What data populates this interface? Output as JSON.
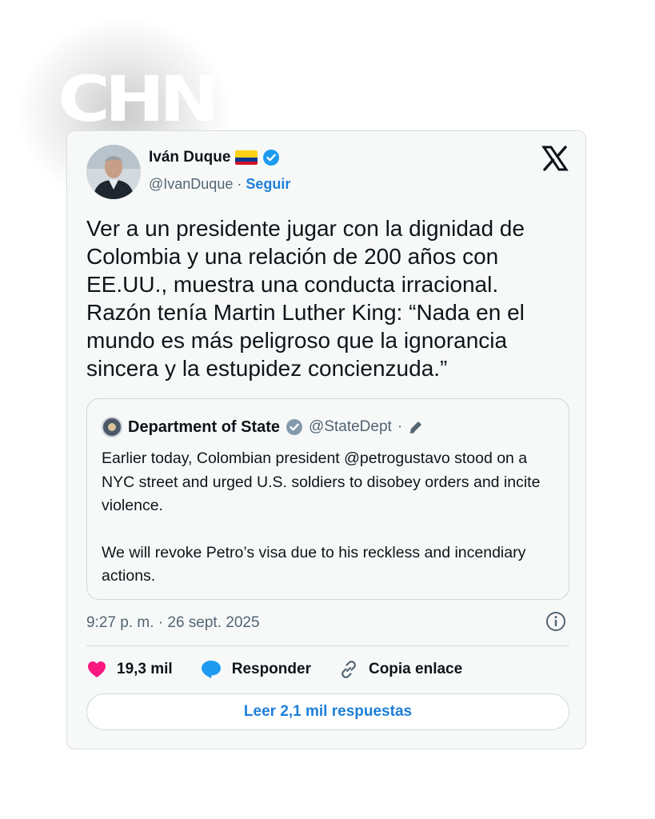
{
  "watermark": {
    "text": "CHN"
  },
  "tweet": {
    "author_name": "Iván Duque",
    "author_handle": "@IvanDuque",
    "separator": " · ",
    "follow_label": "Seguir",
    "text": "Ver a un presidente jugar con la dignidad de Colombia y una relación de 200 años con EE.UU., muestra una conducta irracional. Razón tenía Martin Luther King: “Nada en el mundo es más peligroso que la ignorancia sincera y la estupidez concienzuda.”",
    "timestamp": "9:27 p. m. · 26 sept. 2025",
    "likes": "19,3 mil",
    "reply_label": "Responder",
    "copy_link_label": "Copia enlace",
    "read_replies_label": "Leer 2,1 mil respuestas"
  },
  "quoted_tweet": {
    "author_name": "Department of State",
    "author_handle": "@StateDept",
    "separator": " · ",
    "paragraph_1": "Earlier today, Colombian president @petrogustavo stood on a NYC street and urged U.S. soldiers to disobey orders and incite violence.",
    "paragraph_2": "We will revoke Petro’s visa due to his reckless and incendiary actions."
  },
  "colors": {
    "accent_blue": "#1d7fd9",
    "verified_blue": "#1d9bf0",
    "verified_gray": "#829aab",
    "like_pink": "#f91880"
  },
  "icons": [
    "colombia-flag-icon",
    "verified-badge-icon",
    "x-logo-icon",
    "state-seal-icon",
    "gray-verified-badge-icon",
    "pencil-icon",
    "info-icon",
    "heart-icon",
    "reply-bubble-icon",
    "link-icon"
  ]
}
